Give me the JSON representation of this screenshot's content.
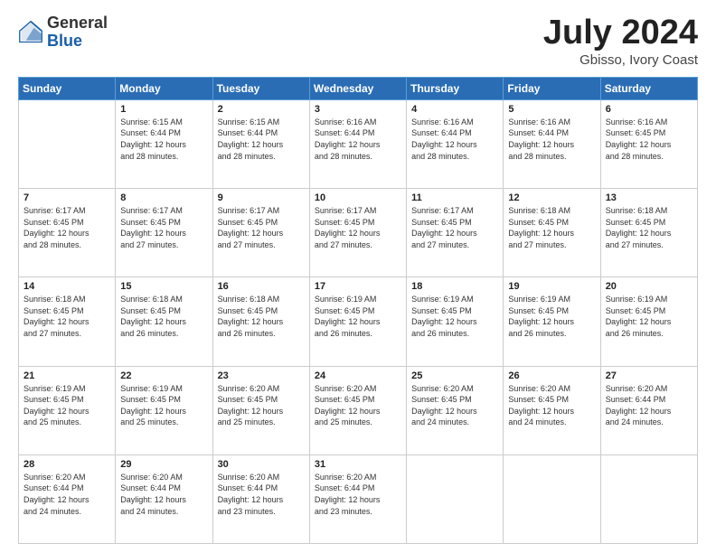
{
  "header": {
    "logo_general": "General",
    "logo_blue": "Blue",
    "month_title": "July 2024",
    "location": "Gbisso, Ivory Coast"
  },
  "days_of_week": [
    "Sunday",
    "Monday",
    "Tuesday",
    "Wednesday",
    "Thursday",
    "Friday",
    "Saturday"
  ],
  "weeks": [
    [
      {
        "day": "",
        "text": ""
      },
      {
        "day": "1",
        "text": "Sunrise: 6:15 AM\nSunset: 6:44 PM\nDaylight: 12 hours\nand 28 minutes."
      },
      {
        "day": "2",
        "text": "Sunrise: 6:15 AM\nSunset: 6:44 PM\nDaylight: 12 hours\nand 28 minutes."
      },
      {
        "day": "3",
        "text": "Sunrise: 6:16 AM\nSunset: 6:44 PM\nDaylight: 12 hours\nand 28 minutes."
      },
      {
        "day": "4",
        "text": "Sunrise: 6:16 AM\nSunset: 6:44 PM\nDaylight: 12 hours\nand 28 minutes."
      },
      {
        "day": "5",
        "text": "Sunrise: 6:16 AM\nSunset: 6:44 PM\nDaylight: 12 hours\nand 28 minutes."
      },
      {
        "day": "6",
        "text": "Sunrise: 6:16 AM\nSunset: 6:45 PM\nDaylight: 12 hours\nand 28 minutes."
      }
    ],
    [
      {
        "day": "7",
        "text": "Sunrise: 6:17 AM\nSunset: 6:45 PM\nDaylight: 12 hours\nand 28 minutes."
      },
      {
        "day": "8",
        "text": "Sunrise: 6:17 AM\nSunset: 6:45 PM\nDaylight: 12 hours\nand 27 minutes."
      },
      {
        "day": "9",
        "text": "Sunrise: 6:17 AM\nSunset: 6:45 PM\nDaylight: 12 hours\nand 27 minutes."
      },
      {
        "day": "10",
        "text": "Sunrise: 6:17 AM\nSunset: 6:45 PM\nDaylight: 12 hours\nand 27 minutes."
      },
      {
        "day": "11",
        "text": "Sunrise: 6:17 AM\nSunset: 6:45 PM\nDaylight: 12 hours\nand 27 minutes."
      },
      {
        "day": "12",
        "text": "Sunrise: 6:18 AM\nSunset: 6:45 PM\nDaylight: 12 hours\nand 27 minutes."
      },
      {
        "day": "13",
        "text": "Sunrise: 6:18 AM\nSunset: 6:45 PM\nDaylight: 12 hours\nand 27 minutes."
      }
    ],
    [
      {
        "day": "14",
        "text": "Sunrise: 6:18 AM\nSunset: 6:45 PM\nDaylight: 12 hours\nand 27 minutes."
      },
      {
        "day": "15",
        "text": "Sunrise: 6:18 AM\nSunset: 6:45 PM\nDaylight: 12 hours\nand 26 minutes."
      },
      {
        "day": "16",
        "text": "Sunrise: 6:18 AM\nSunset: 6:45 PM\nDaylight: 12 hours\nand 26 minutes."
      },
      {
        "day": "17",
        "text": "Sunrise: 6:19 AM\nSunset: 6:45 PM\nDaylight: 12 hours\nand 26 minutes."
      },
      {
        "day": "18",
        "text": "Sunrise: 6:19 AM\nSunset: 6:45 PM\nDaylight: 12 hours\nand 26 minutes."
      },
      {
        "day": "19",
        "text": "Sunrise: 6:19 AM\nSunset: 6:45 PM\nDaylight: 12 hours\nand 26 minutes."
      },
      {
        "day": "20",
        "text": "Sunrise: 6:19 AM\nSunset: 6:45 PM\nDaylight: 12 hours\nand 26 minutes."
      }
    ],
    [
      {
        "day": "21",
        "text": "Sunrise: 6:19 AM\nSunset: 6:45 PM\nDaylight: 12 hours\nand 25 minutes."
      },
      {
        "day": "22",
        "text": "Sunrise: 6:19 AM\nSunset: 6:45 PM\nDaylight: 12 hours\nand 25 minutes."
      },
      {
        "day": "23",
        "text": "Sunrise: 6:20 AM\nSunset: 6:45 PM\nDaylight: 12 hours\nand 25 minutes."
      },
      {
        "day": "24",
        "text": "Sunrise: 6:20 AM\nSunset: 6:45 PM\nDaylight: 12 hours\nand 25 minutes."
      },
      {
        "day": "25",
        "text": "Sunrise: 6:20 AM\nSunset: 6:45 PM\nDaylight: 12 hours\nand 24 minutes."
      },
      {
        "day": "26",
        "text": "Sunrise: 6:20 AM\nSunset: 6:45 PM\nDaylight: 12 hours\nand 24 minutes."
      },
      {
        "day": "27",
        "text": "Sunrise: 6:20 AM\nSunset: 6:44 PM\nDaylight: 12 hours\nand 24 minutes."
      }
    ],
    [
      {
        "day": "28",
        "text": "Sunrise: 6:20 AM\nSunset: 6:44 PM\nDaylight: 12 hours\nand 24 minutes."
      },
      {
        "day": "29",
        "text": "Sunrise: 6:20 AM\nSunset: 6:44 PM\nDaylight: 12 hours\nand 24 minutes."
      },
      {
        "day": "30",
        "text": "Sunrise: 6:20 AM\nSunset: 6:44 PM\nDaylight: 12 hours\nand 23 minutes."
      },
      {
        "day": "31",
        "text": "Sunrise: 6:20 AM\nSunset: 6:44 PM\nDaylight: 12 hours\nand 23 minutes."
      },
      {
        "day": "",
        "text": ""
      },
      {
        "day": "",
        "text": ""
      },
      {
        "day": "",
        "text": ""
      }
    ]
  ]
}
